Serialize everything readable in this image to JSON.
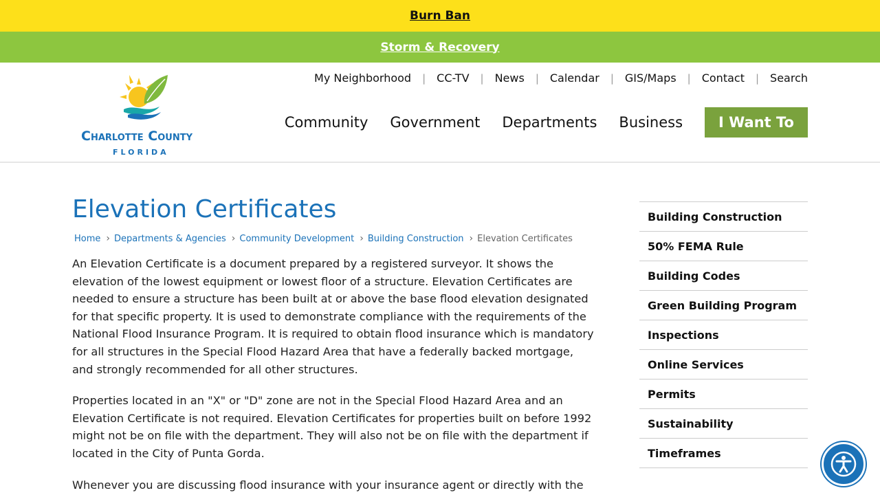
{
  "alerts": {
    "burn_ban": "Burn Ban",
    "storm": "Storm & Recovery"
  },
  "logo": {
    "name": "Charlotte County",
    "state": "FLORIDA"
  },
  "utility_nav": [
    "My Neighborhood",
    "CC-TV",
    "News",
    "Calendar",
    "GIS/Maps",
    "Contact",
    "Search"
  ],
  "main_nav": {
    "community": "Community",
    "government": "Government",
    "departments": "Departments",
    "business": "Business",
    "i_want_to": "I Want To"
  },
  "page": {
    "title": "Elevation Certificates",
    "breadcrumb": [
      "Home",
      "Departments & Agencies",
      "Community Development",
      "Building Construction"
    ],
    "breadcrumb_current": "Elevation Certificates",
    "paragraphs": [
      "An Elevation Certificate is a document prepared by a registered surveyor. It shows the elevation of the lowest equipment or lowest floor of a structure. Elevation Certificates are needed to ensure a structure has been built at or above the base flood elevation designated for that specific property. It is used to demonstrate compliance with the requirements of the National Flood Insurance Program. It is required to obtain flood insurance which is mandatory for all structures in the Special Flood Hazard Area that have a federally backed mortgage, and strongly recommended for all other structures.",
      "Properties located in an \"X\" or \"D\" zone are not in the Special Flood Hazard Area and an Elevation Certificate is not required. Elevation Certificates for properties built on before 1992 might not be on file with the department. They will also not be on file with the department if located in the City of Punta Gorda.",
      "Whenever you are discussing flood insurance with your insurance agent or directly with the"
    ]
  },
  "sidebar": [
    "Building Construction",
    "50% FEMA Rule",
    "Building Codes",
    "Green Building Program",
    "Inspections",
    "Online Services",
    "Permits",
    "Sustainability",
    "Timeframes"
  ],
  "colors": {
    "burn_ban_bg": "#fde01a",
    "storm_bg": "#8dc63f",
    "brand_blue": "#1b72b8",
    "i_want_to_bg": "#7aa23d"
  }
}
